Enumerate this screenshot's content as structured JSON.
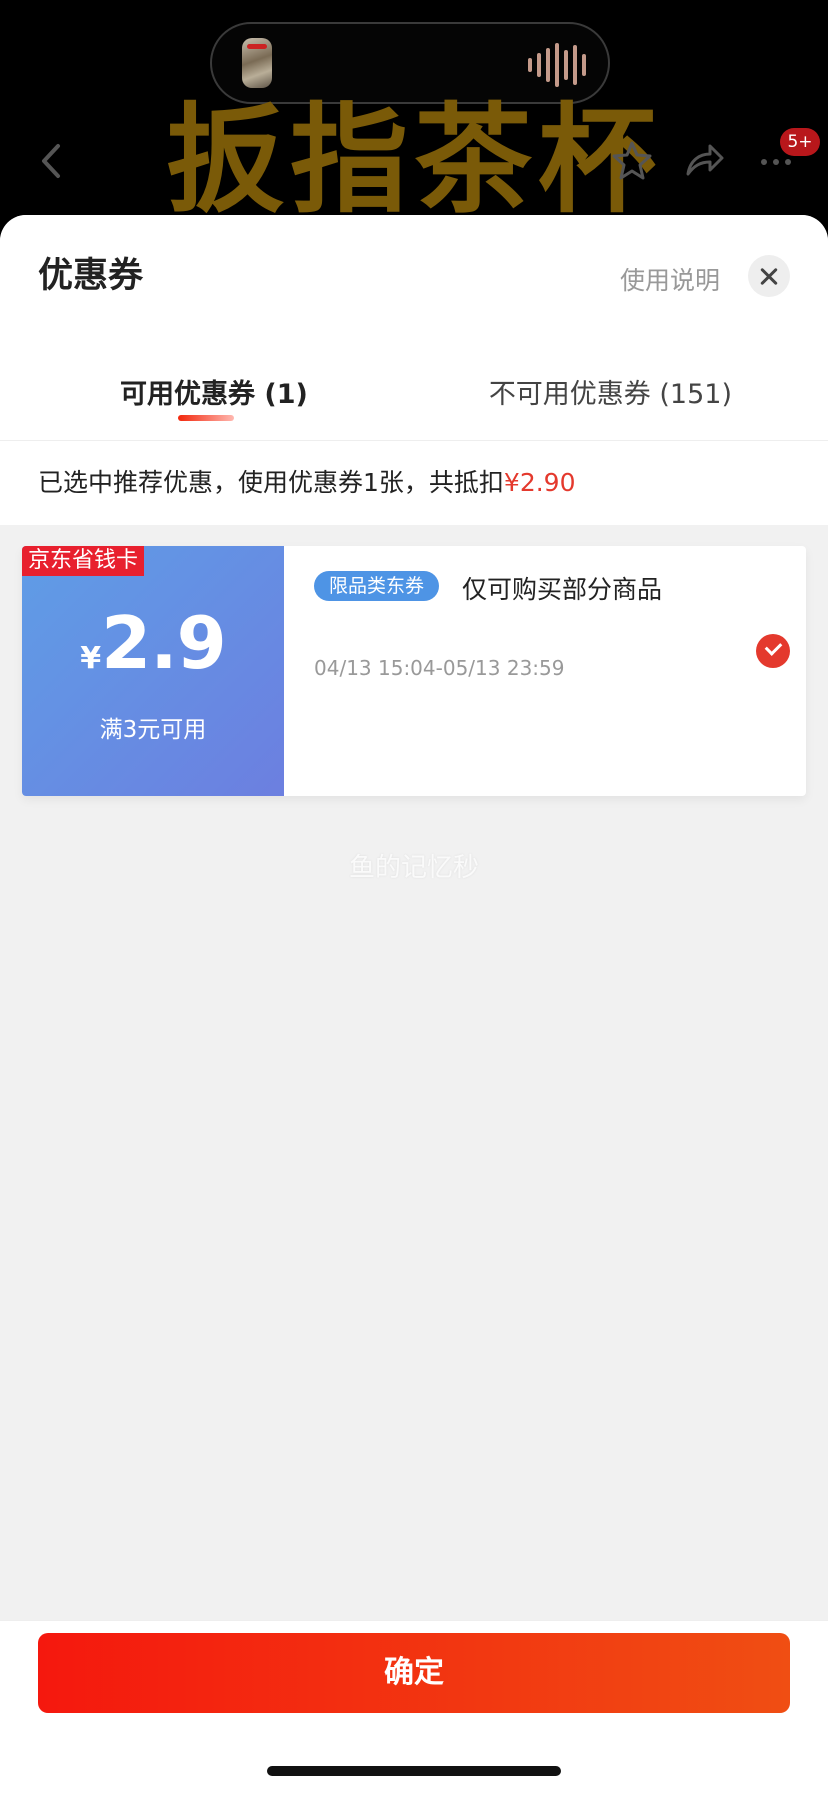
{
  "background": {
    "product_title": "扳指茶杯",
    "notification_badge": "5+",
    "icons": [
      "back-icon",
      "star-icon",
      "share-icon",
      "more-icon"
    ]
  },
  "sheet": {
    "title": "优惠券",
    "help_link": "使用说明",
    "tabs": [
      {
        "label": "可用优惠券 (1)",
        "active": true
      },
      {
        "label": "不可用优惠券 (151)",
        "active": false
      }
    ],
    "summary_prefix": "已选中推荐优惠，使用优惠券1张，共抵扣",
    "summary_amount": "¥2.90"
  },
  "coupons": [
    {
      "corner_tag": "京东省钱卡",
      "currency": "¥",
      "amount": "2.9",
      "threshold": "满3元可用",
      "category_tag": "限品类东券",
      "description": "仅可购买部分商品",
      "valid_period": "04/13 15:04-05/13 23:59",
      "selected": true
    }
  ],
  "watermark": "鱼的记忆秒",
  "footer": {
    "confirm_label": "确定"
  },
  "colors": {
    "accent_red": "#e4392d",
    "button_red": "#f5180e",
    "coupon_blue": "#5f9de6"
  }
}
